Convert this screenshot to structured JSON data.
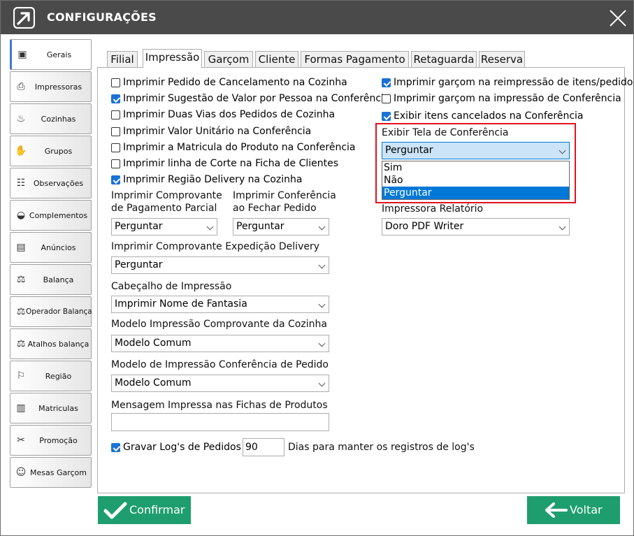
{
  "window": {
    "title": "CONFIGURAÇÕES"
  },
  "nav": {
    "items": [
      {
        "label": "Gerais",
        "icon": "monitor-icon"
      },
      {
        "label": "Impressoras",
        "icon": "printer-icon"
      },
      {
        "label": "Cozinhas",
        "icon": "kitchen-icon"
      },
      {
        "label": "Grupos",
        "icon": "groups-icon"
      },
      {
        "label": "Observações",
        "icon": "clipboard-icon"
      },
      {
        "label": "Complementos",
        "icon": "dish-icon"
      },
      {
        "label": "Anúncios",
        "icon": "document-icon"
      },
      {
        "label": "Balança",
        "icon": "scale-icon"
      },
      {
        "label": "Operador Balança",
        "icon": "scale-operator-icon"
      },
      {
        "label": "Atalhos balança",
        "icon": "scale-shortcut-icon"
      },
      {
        "label": "Região",
        "icon": "flag-icon"
      },
      {
        "label": "Matriculas",
        "icon": "barcode-icon"
      },
      {
        "label": "Promoção",
        "icon": "promotion-icon"
      },
      {
        "label": "Mesas Garçom",
        "icon": "waiter-icon"
      }
    ]
  },
  "tabs": [
    "Filial",
    "Impressão",
    "Garçom",
    "Cliente",
    "Formas Pagamento",
    "Retaguarda",
    "Reserva"
  ],
  "left_checks": [
    {
      "label": "Imprimir Pedido de Cancelamento na Cozinha",
      "checked": false
    },
    {
      "label": "Imprimir Sugestão de Valor por Pessoa na Conferência",
      "checked": true
    },
    {
      "label": "Imprimir Duas Vias dos Pedidos de Cozinha",
      "checked": false
    },
    {
      "label": "Imprimir Valor Unitário na Conferência",
      "checked": false
    },
    {
      "label": "Imprimir a Matricula do Produto na Conferência",
      "checked": false
    },
    {
      "label": "Imprimir linha de Corte na Ficha de Clientes",
      "checked": false
    },
    {
      "label": "Imprimir Região Delivery na Cozinha",
      "checked": true
    }
  ],
  "right_checks": [
    {
      "label": "Imprimir garçom na reimpressão de itens/pedido",
      "checked": true
    },
    {
      "label": "Imprimir garçom na impressão de Conferência",
      "checked": false
    },
    {
      "label": "Exibir itens cancelados na Conferência",
      "checked": true
    }
  ],
  "comprovante_parcial": {
    "label1": "Imprimir Comprovante",
    "label2": "de Pagamento Parcial",
    "value": "Perguntar"
  },
  "conferencia_fechar": {
    "label1": "Imprimir Conferência",
    "label2": "ao Fechar Pedido",
    "value": "Perguntar"
  },
  "comprovante_delivery": {
    "label": "Imprimir Comprovante Expedição Delivery",
    "value": "Perguntar"
  },
  "cabecalho": {
    "label": "Cabeçalho de Impressão",
    "value": "Imprimir Nome de Fantasia"
  },
  "modelo_cozinha": {
    "label": "Modelo Impressão Comprovante da Cozinha",
    "value": "Modelo Comum"
  },
  "modelo_conferencia": {
    "label": "Modelo de Impressão Conferência de Pedido",
    "value": "Modelo Comum"
  },
  "mensagem": {
    "label": "Mensagem Impressa nas Fichas de Produtos",
    "value": ""
  },
  "log": {
    "label": "Gravar Log's de Pedidos",
    "checked": true,
    "days": "90",
    "suffix": "Dias para manter os registros de log's"
  },
  "tela_conferencia": {
    "label": "Exibir Tela de Conferência",
    "value": "Perguntar",
    "options": [
      "Sim",
      "Não",
      "Perguntar"
    ]
  },
  "impressora_relatorio": {
    "label": "Impressora Relatório",
    "value": "Doro PDF Writer"
  },
  "buttons": {
    "confirm": "Confirmar",
    "back": "Voltar"
  },
  "colors": {
    "titlebar": "#4a4a4a",
    "accent": "#1e9e6e",
    "check": "#1a72d6",
    "highlight": "#e3101e"
  }
}
